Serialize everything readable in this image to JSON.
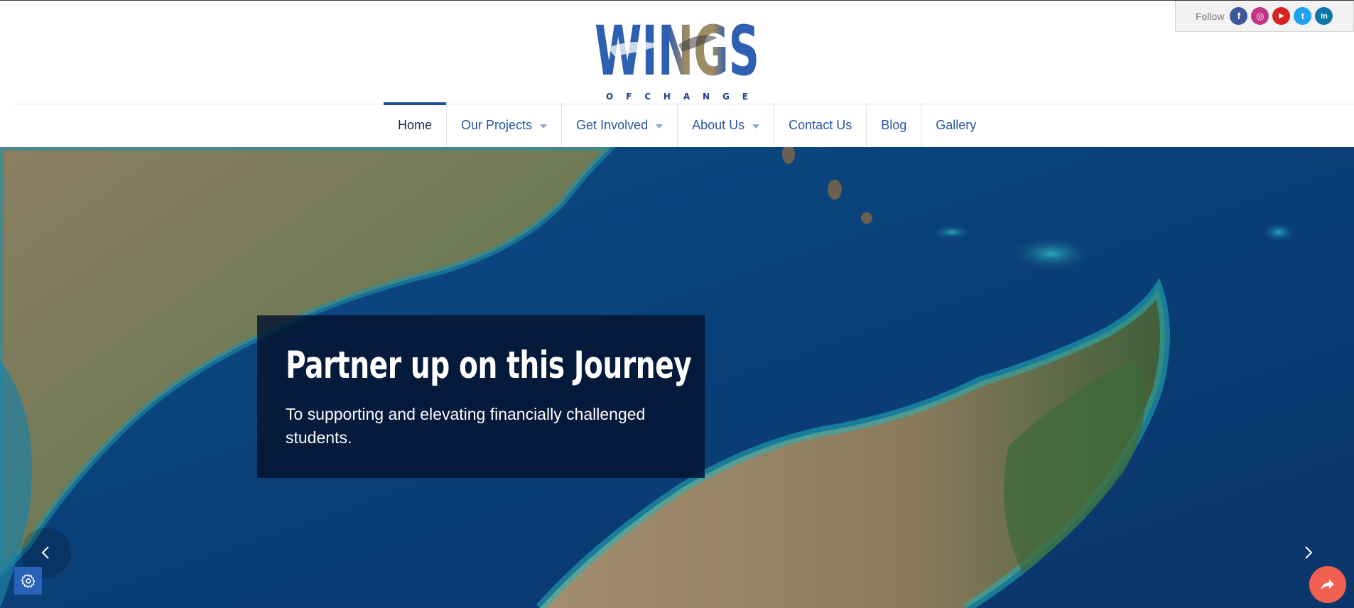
{
  "logo": {
    "word": "WINGS",
    "sub": [
      "O",
      "F",
      "C",
      "H",
      "A",
      "N",
      "G",
      "E"
    ]
  },
  "follow": {
    "label": "Follow",
    "networks": [
      {
        "name": "facebook",
        "glyph": "f",
        "color": "#3b5998"
      },
      {
        "name": "instagram",
        "glyph": "◎",
        "color": "#c13584"
      },
      {
        "name": "youtube",
        "glyph": "▶",
        "color": "#d92323"
      },
      {
        "name": "twitter",
        "glyph": "t",
        "color": "#1da1f2"
      },
      {
        "name": "linkedin",
        "glyph": "in",
        "color": "#0e76a8"
      }
    ]
  },
  "nav": {
    "items": [
      {
        "label": "Home",
        "active": true,
        "dropdown": false
      },
      {
        "label": "Our Projects",
        "active": false,
        "dropdown": true
      },
      {
        "label": "Get Involved",
        "active": false,
        "dropdown": true
      },
      {
        "label": "About Us",
        "active": false,
        "dropdown": true
      },
      {
        "label": "Contact Us",
        "active": false,
        "dropdown": false
      },
      {
        "label": "Blog",
        "active": false,
        "dropdown": false
      },
      {
        "label": "Gallery",
        "active": false,
        "dropdown": false
      }
    ]
  },
  "hero": {
    "title": "Partner up on this Journey",
    "text": "To supporting and elevating financially challenged students."
  },
  "colors": {
    "brand_blue": "#2656a4",
    "share_button": "#f2604f",
    "settings_button": "#2962b8"
  }
}
